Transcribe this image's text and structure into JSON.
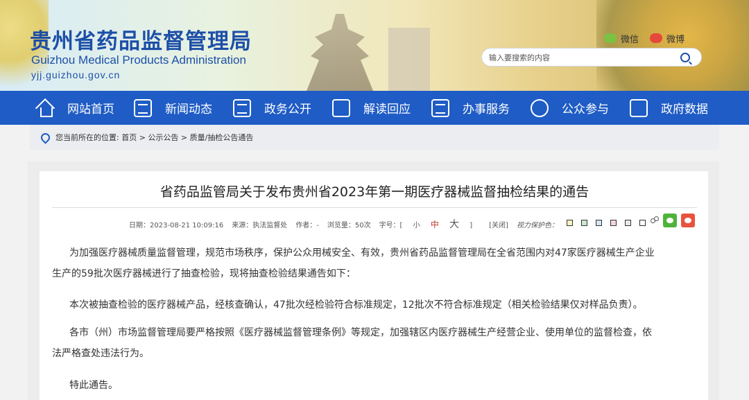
{
  "header": {
    "site_name_cn": "贵州省药品监督管理局",
    "site_name_en": "Guizhou Medical Products Administration",
    "site_url": "yjj.guizhou.gov.cn",
    "wechat_label": "微信",
    "weibo_label": "微博",
    "search_placeholder": "输入要搜索的内容"
  },
  "nav": {
    "items": [
      {
        "label": "网站首页",
        "icon": "home-icon"
      },
      {
        "label": "新闻动态",
        "icon": "news-icon"
      },
      {
        "label": "政务公开",
        "icon": "document-icon"
      },
      {
        "label": "解读回应",
        "icon": "book-icon"
      },
      {
        "label": "办事服务",
        "icon": "service-icon"
      },
      {
        "label": "公众参与",
        "icon": "chat-icon"
      },
      {
        "label": "政府数据",
        "icon": "data-icon"
      }
    ]
  },
  "breadcrumb": "您当前所在的位置: 首页 > 公示公告 > 质量/抽检公告通告",
  "article": {
    "title": "省药品监管局关于发布贵州省2023年第一期医疗器械监督抽检结果的通告",
    "date": "日期：2023-08-21 10:09:16",
    "source": "来源：执法监督处",
    "author": "作者：-",
    "views": "浏览量：50次",
    "font_size_label": "字号：[",
    "size_small": "小",
    "size_medium": "中",
    "size_large": "大",
    "close_bracket": "]",
    "close": "[关闭]",
    "protect_label": "视力保护色：",
    "protect_colors": [
      "#f9f3c1",
      "#cce8cf",
      "#d3e4f5",
      "#f3d6dc",
      "#e8e8e8",
      "#ffffff"
    ],
    "paragraph1_line1": "为加强医疗器械质量监督管理，规范市场秩序，保护公众用械安全、有效，贵州省药品监督管理局在全省范围内对47家医疗器械生产企业",
    "paragraph1_line2": "生产的59批次医疗器械进行了抽查检验，现将抽查检验结果通告如下：",
    "paragraph2": "本次被抽查检验的医疗器械产品，经核查确认，47批次经检验符合标准规定，12批次不符合标准规定（相关检验结果仅对样品负责）。",
    "paragraph3_line1": "各市（州）市场监督管理局要严格按照《医疗器械监督管理条例》等规定，加强辖区内医疗器械生产经营企业、使用单位的监督检查，依",
    "paragraph3_line2": "法严格查处违法行为。",
    "paragraph4": "特此通告。"
  }
}
